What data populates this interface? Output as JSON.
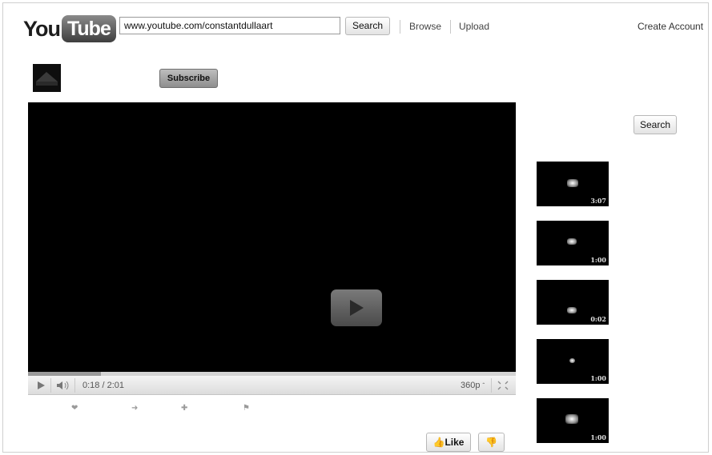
{
  "header": {
    "logo_you": "You",
    "logo_tube": "Tube",
    "search_value": "www.youtube.com/constantdullaart",
    "search_button": "Search",
    "nav": [
      "Browse",
      "Upload"
    ],
    "create_account": "Create Account"
  },
  "channel": {
    "subscribe_label": "Subscribe"
  },
  "player": {
    "time": "0:18 / 2:01",
    "quality": "360p",
    "progress": 0.15
  },
  "actions": {
    "like_label": "Like"
  },
  "sidebar": {
    "search_button": "Search",
    "thumbnails": [
      {
        "duration": "3:07"
      },
      {
        "duration": "1:00"
      },
      {
        "duration": "0:02"
      },
      {
        "duration": "1:00"
      },
      {
        "duration": "1:00"
      }
    ]
  },
  "icons": {
    "play": "play-icon",
    "volume": "volume-icon",
    "fullscreen": "fullscreen-icon",
    "heart": "heart-icon",
    "share": "share-icon",
    "add": "add-icon",
    "flag": "flag-icon",
    "thumbs_up": "thumbs-up-icon",
    "thumbs_down": "thumbs-down-icon"
  },
  "colors": {
    "player_bg": "#000000",
    "subscribe_bg": "#9e9e9e"
  }
}
